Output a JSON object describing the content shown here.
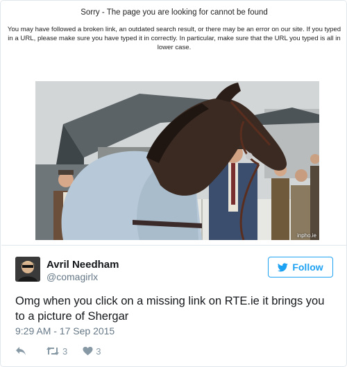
{
  "error_page": {
    "title": "Sorry - The page you are looking for cannot be found",
    "body": "You may have followed a broken link, an outdated search result, or there may be an error on our site. If you typed in a URL, please make sure you have typed it in correctly. In particular, make sure that the URL you typed is all in lower case.",
    "photo_credit": "inpho.ie"
  },
  "tweet": {
    "author_name": "Avril Needham",
    "author_handle": "@comagirlx",
    "follow_label": "Follow",
    "text": "Omg when you click on a missing link on RTE.ie it brings you to a picture of Shergar",
    "timestamp": "9:29 AM - 17 Sep 2015",
    "retweet_count": "3",
    "like_count": "3"
  },
  "colors": {
    "twitter_blue": "#1da1f2",
    "muted_text": "#657786",
    "action_gray": "#8899a6"
  },
  "icons": {
    "follow": "twitter-bird-icon",
    "reply": "reply-icon",
    "retweet": "retweet-icon",
    "like": "heart-icon"
  }
}
